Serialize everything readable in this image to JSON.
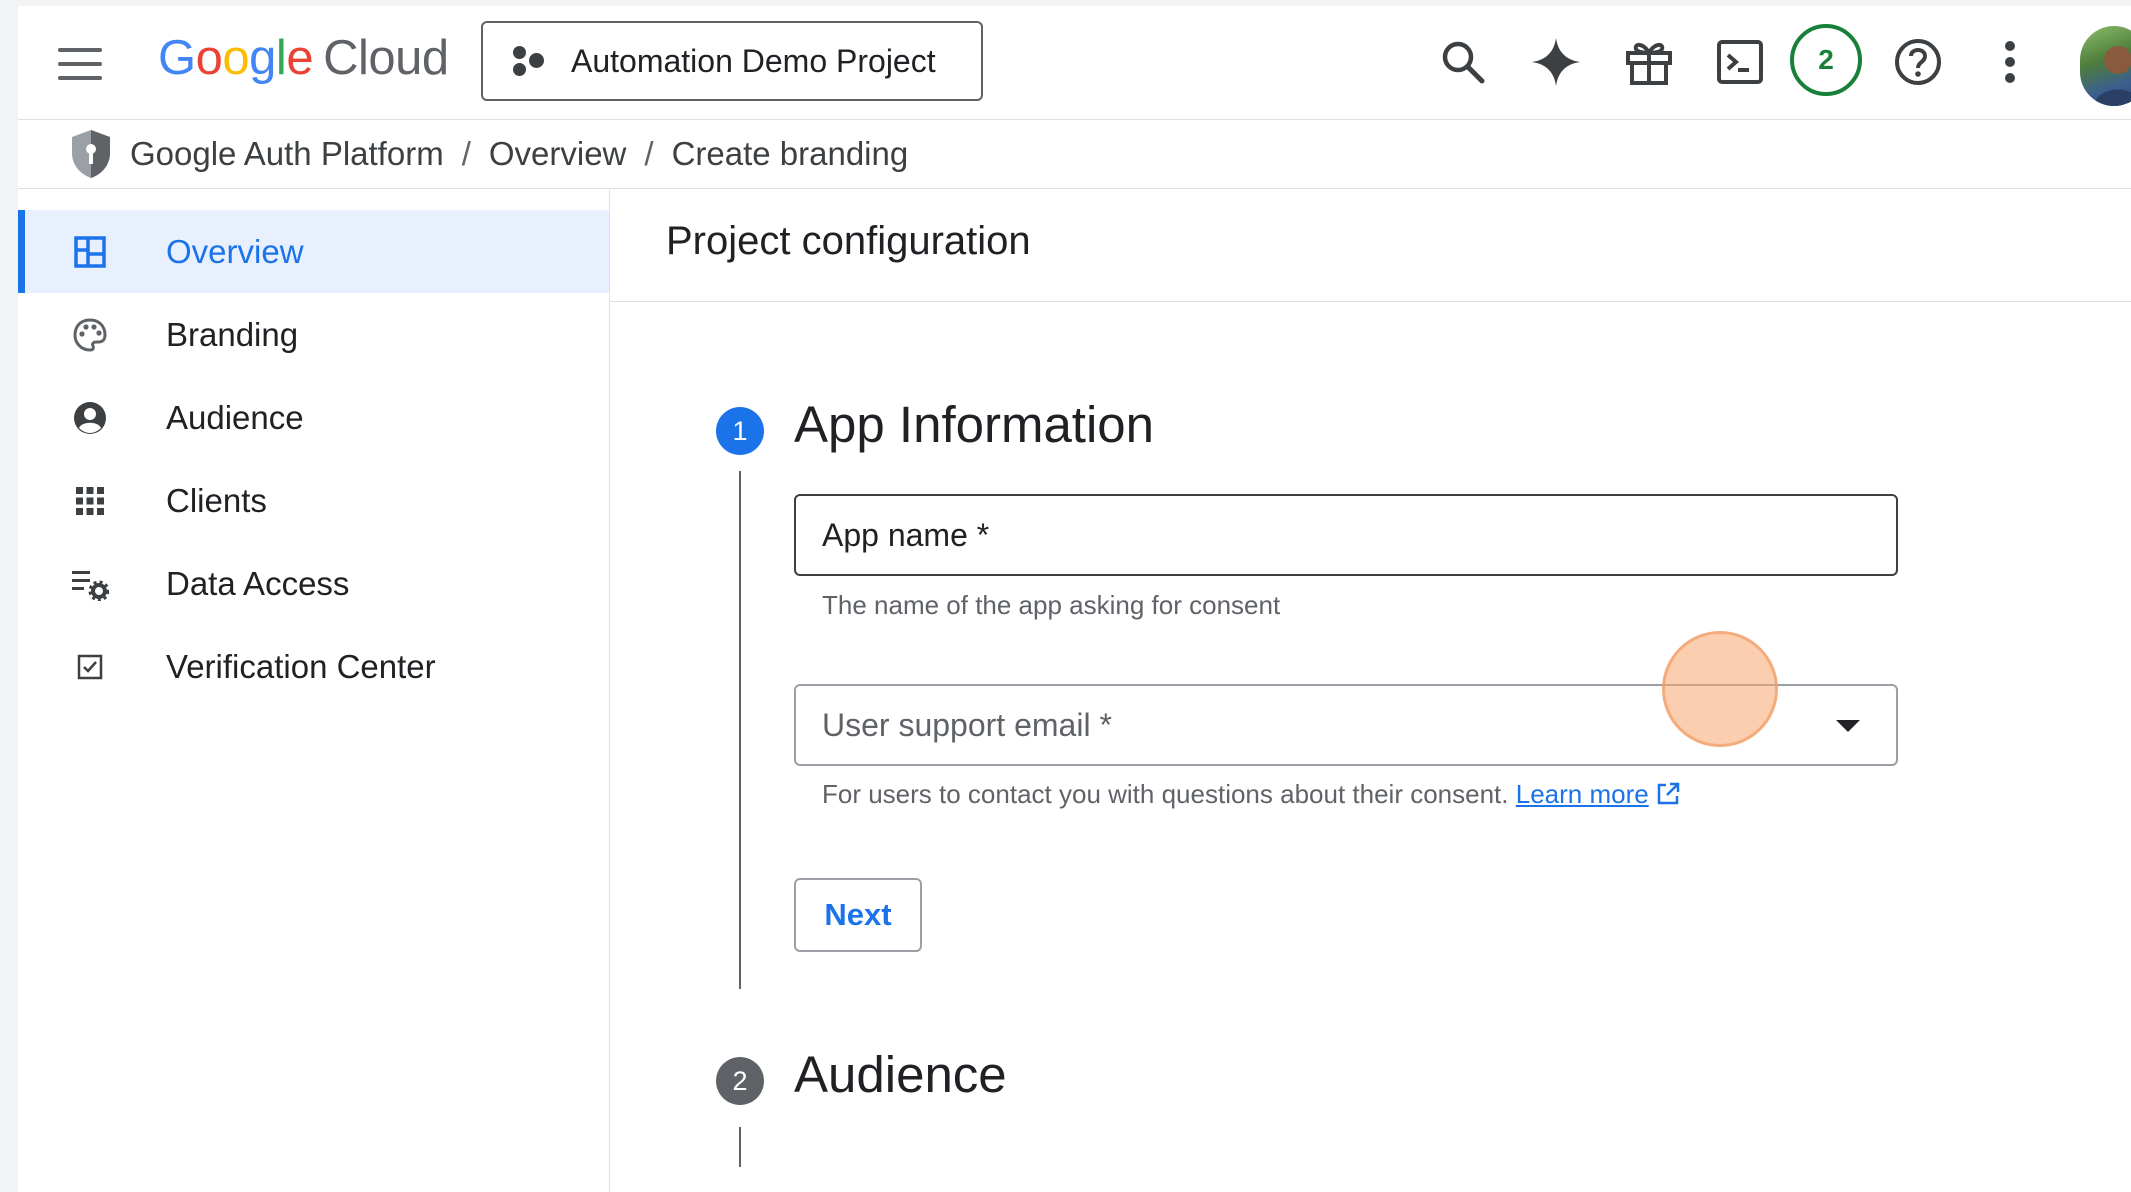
{
  "topbar": {
    "logo": {
      "google": [
        "G",
        "o",
        "o",
        "g",
        "l",
        "e"
      ],
      "product": "Cloud"
    },
    "project": {
      "label": "Automation Demo Project",
      "icon": "project-hub-icon"
    },
    "notification_count": "2",
    "icons": [
      "menu-icon",
      "search-icon",
      "gemini-spark-icon",
      "gift-icon",
      "cloud-shell-icon",
      "notifications-badge",
      "help-icon",
      "more-vert-icon",
      "avatar"
    ]
  },
  "breadcrumb": {
    "items": [
      "Google Auth Platform",
      "Overview",
      "Create branding"
    ],
    "separator": "/"
  },
  "sidebar": {
    "items": [
      {
        "label": "Overview",
        "icon": "dashboard-icon",
        "active": true
      },
      {
        "label": "Branding",
        "icon": "palette-icon",
        "active": false
      },
      {
        "label": "Audience",
        "icon": "account-circle-icon",
        "active": false
      },
      {
        "label": "Clients",
        "icon": "apps-grid-icon",
        "active": false
      },
      {
        "label": "Data Access",
        "icon": "list-settings-icon",
        "active": false
      },
      {
        "label": "Verification Center",
        "icon": "checkbox-icon",
        "active": false
      }
    ]
  },
  "main": {
    "title": "Project configuration",
    "steps": [
      {
        "number": "1",
        "title": "App Information",
        "state": "active"
      },
      {
        "number": "2",
        "title": "Audience",
        "state": "pending"
      }
    ],
    "form": {
      "app_name": {
        "label": "App name *",
        "hint": "The name of the app asking for consent"
      },
      "support_email": {
        "label": "User support email *",
        "hint": "For users to contact you with questions about their consent.",
        "link": "Learn more"
      },
      "next_label": "Next"
    }
  },
  "colors": {
    "accent": "#1a73e8",
    "active_bg": "#e8f0fe",
    "badge_green": "#188038",
    "step_active": "#1a73e8",
    "step_pending": "#5f6368"
  }
}
